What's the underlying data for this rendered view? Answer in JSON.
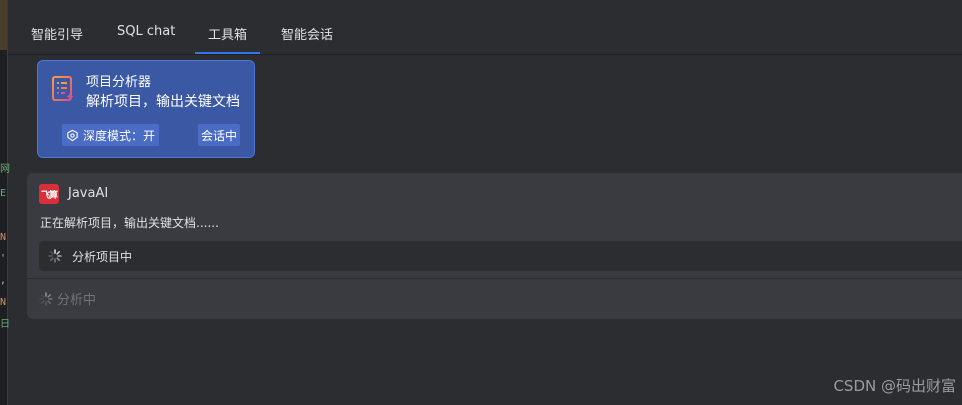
{
  "tabs": [
    {
      "label": "智能引导",
      "active": false
    },
    {
      "label": "SQL chat",
      "active": false
    },
    {
      "label": "工具箱",
      "active": true
    },
    {
      "label": "智能会话",
      "active": false
    }
  ],
  "tool_card": {
    "title": "项目分析器",
    "description": "解析项目，输出关键文档",
    "icon": "document-list-icon",
    "deep_mode_label": "深度模式：开",
    "session_label": "会话中"
  },
  "message": {
    "bot_logo_text": "飞算",
    "bot_name": "JavaAI",
    "text": "正在解析项目，输出关键文档......",
    "progress_label": "分析项目中",
    "status_label": "分析中"
  },
  "watermark": "CSDN @码出财富",
  "colors": {
    "accent": "#3574f0",
    "card_bg": "#3a58a4",
    "brand_red": "#d7303b",
    "panel_bg": "#393b40",
    "page_bg": "#2b2d30"
  }
}
